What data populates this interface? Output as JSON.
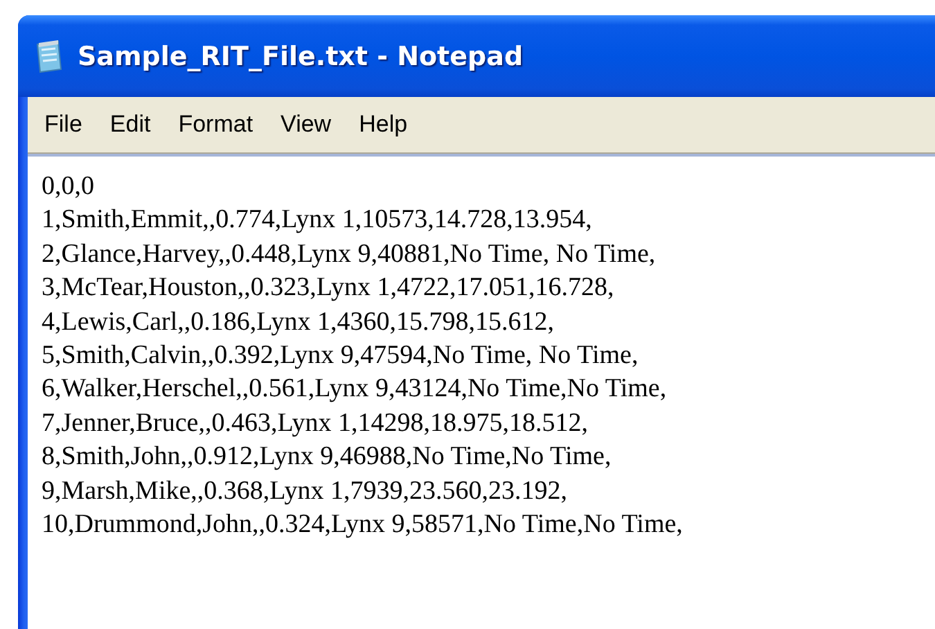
{
  "window": {
    "title": "Sample_RIT_File.txt - Notepad"
  },
  "menu": [
    "File",
    "Edit",
    "Format",
    "View",
    "Help"
  ],
  "document": {
    "lines": [
      "0,0,0",
      "1,Smith,Emmit,,0.774,Lynx 1,10573,14.728,13.954,",
      "2,Glance,Harvey,,0.448,Lynx 9,40881,No Time, No Time,",
      "3,McTear,Houston,,0.323,Lynx 1,4722,17.051,16.728,",
      "4,Lewis,Carl,,0.186,Lynx 1,4360,15.798,15.612,",
      "5,Smith,Calvin,,0.392,Lynx 9,47594,No Time, No Time,",
      "6,Walker,Herschel,,0.561,Lynx 9,43124,No Time,No Time,",
      "7,Jenner,Bruce,,0.463,Lynx 1,14298,18.975,18.512,",
      "8,Smith,John,,0.912,Lynx 9,46988,No Time,No Time,",
      "9,Marsh,Mike,,0.368,Lynx 1,7939,23.560,23.192,",
      "10,Drummond,John,,0.324,Lynx 9,58571,No Time,No Time,"
    ]
  }
}
